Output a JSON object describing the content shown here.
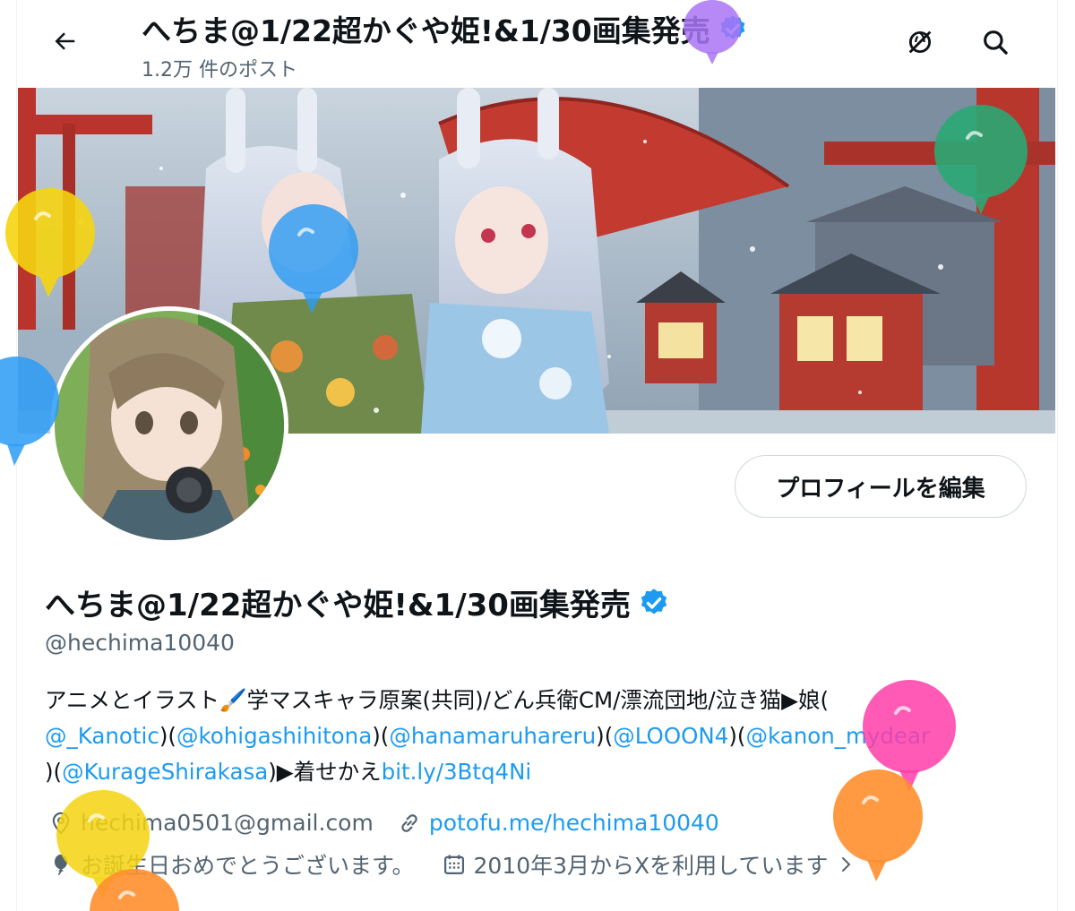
{
  "header": {
    "title": "へちま@1/22超かぐや姫!&1/30画集発売",
    "post_count": "1.2万 件のポスト",
    "icons": [
      "back-arrow-icon",
      "verified-badge-icon",
      "no-translate-icon",
      "search-icon"
    ]
  },
  "profile": {
    "name": "へちま@1/22超かぐや姫!&1/30画集発売",
    "handle": "@hechima10040",
    "edit_label": "プロフィールを編集"
  },
  "bio": {
    "line1_text": "アニメとイラスト🖌️学マスキャラ原案(共同)/どん兵衛CM/漂流団地/泣き猫▶娘(",
    "line2": {
      "m1": "@_Kanotic",
      "s1": ")(",
      "m2": "@kohigashihitona",
      "s2": ")(",
      "m3": "@hanamaruhareru",
      "s3": ")(",
      "m4": "@LOOON4",
      "s4": ")(",
      "m5": "@kanon_mydear"
    },
    "line3": {
      "s0": ")(",
      "m6": "@KurageShirakasa",
      "s1": ")▶着せかえ",
      "url": "bit.ly/3Btq4Ni"
    }
  },
  "meta": {
    "email": "hechima0501@gmail.com",
    "website": "potofu.me/hechima10040",
    "birthday": "お誕生日おめでとうございます。",
    "joined": "2010年3月からXを利用しています"
  },
  "colors": {
    "accent": "#1d9bf0",
    "text": "#0f1419",
    "muted": "#536471",
    "border": "#cfd9de"
  },
  "balloon_colors": [
    "#a974f6",
    "#2aa874",
    "#f5d40f",
    "#2b9bf4",
    "#ff3da8",
    "#ff8f2d"
  ]
}
